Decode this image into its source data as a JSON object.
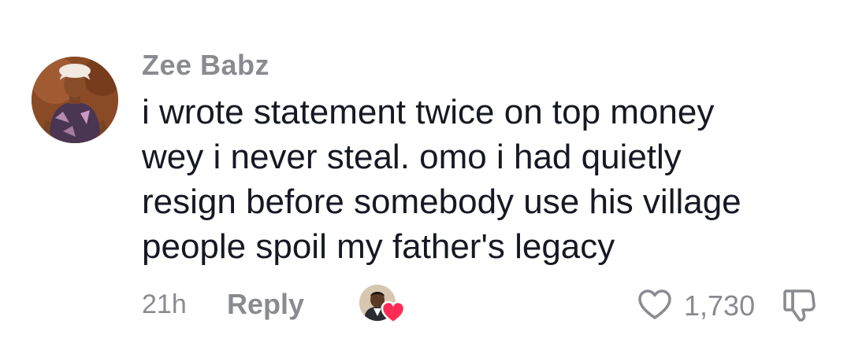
{
  "comment": {
    "username": "Zee Babz",
    "lines": [
      "i wrote statement twice on top money",
      "wey i never steal. omo i had quietly",
      "resign before somebody use his village",
      "people spoil my father's legacy"
    ],
    "time": "21h",
    "reply_label": "Reply",
    "like_count": "1,730",
    "liked_by_creator": true,
    "icons": {
      "like": "heart-outline-icon",
      "dislike": "thumbs-down-outline-icon",
      "creator_badge": "red-heart-icon"
    },
    "colors": {
      "muted_text": "#8a8b91",
      "body_text": "#161823",
      "creator_heart": "#fe2c55"
    }
  }
}
